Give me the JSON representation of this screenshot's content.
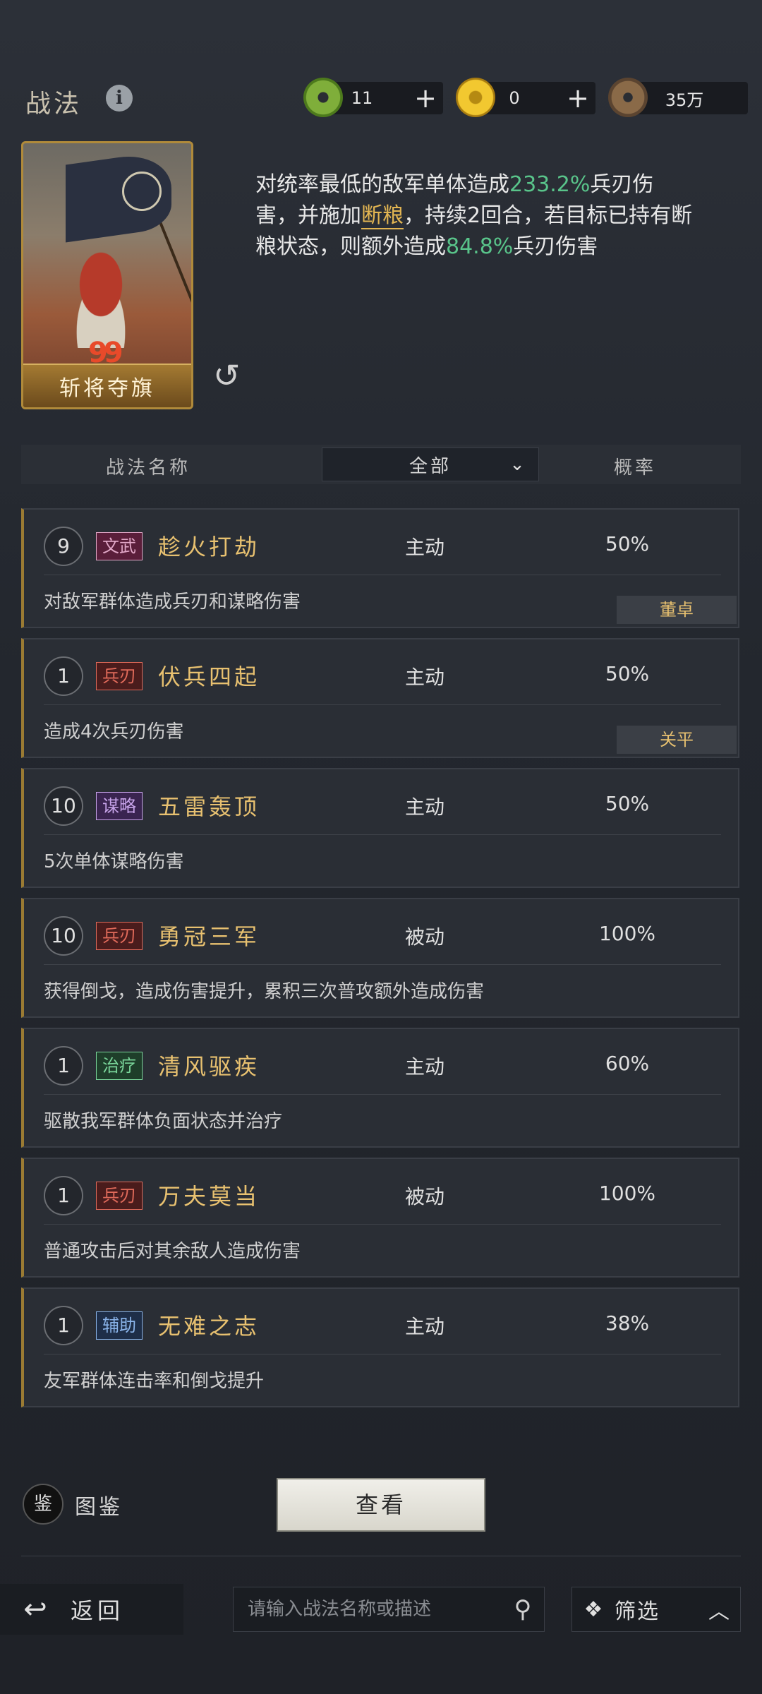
{
  "header": {
    "title": "战法",
    "info_icon": "i",
    "resources": [
      {
        "icon": "jade-coin-icon",
        "value": "11",
        "plus": "+"
      },
      {
        "icon": "gold-coin-icon",
        "value": "0",
        "plus": "+"
      },
      {
        "icon": "copper-coin-icon",
        "value": "35万"
      }
    ]
  },
  "selected": {
    "card_name": "斩将夺旗",
    "card_badge": "99",
    "description": {
      "p1": "对统率最低的敌军单体造成",
      "v1": "233.2%",
      "p2": "兵刃伤害，并施加",
      "link": "断粮",
      "p3": "，持续2回合，若目标已持有断粮状态，则额外造成",
      "v2": "84.8%",
      "p4": "兵刃伤害"
    }
  },
  "table_header": {
    "name": "战法名称",
    "filter": "全部",
    "rate": "概率"
  },
  "tactics": [
    {
      "level": "9",
      "tag": "文武",
      "tag_class": "tag-wenwu",
      "name": "趁火打劫",
      "kind": "主动",
      "rate": "50%",
      "desc": "对敌军群体造成兵刃和谋略伤害",
      "owner": "董卓"
    },
    {
      "level": "1",
      "tag": "兵刃",
      "tag_class": "tag-bing",
      "name": "伏兵四起",
      "kind": "主动",
      "rate": "50%",
      "desc": "造成4次兵刃伤害",
      "owner": "关平"
    },
    {
      "level": "10",
      "tag": "谋略",
      "tag_class": "tag-mou",
      "name": "五雷轰顶",
      "kind": "主动",
      "rate": "50%",
      "desc": "5次单体谋略伤害",
      "owner": ""
    },
    {
      "level": "10",
      "tag": "兵刃",
      "tag_class": "tag-bing",
      "name": "勇冠三军",
      "kind": "被动",
      "rate": "100%",
      "desc": "获得倒戈，造成伤害提升，累积三次普攻额外造成伤害",
      "owner": ""
    },
    {
      "level": "1",
      "tag": "治疗",
      "tag_class": "tag-zhi",
      "name": "清风驱疾",
      "kind": "主动",
      "rate": "60%",
      "desc": "驱散我军群体负面状态并治疗",
      "owner": ""
    },
    {
      "level": "1",
      "tag": "兵刃",
      "tag_class": "tag-bing",
      "name": "万夫莫当",
      "kind": "被动",
      "rate": "100%",
      "desc": "普通攻击后对其余敌人造成伤害",
      "owner": ""
    },
    {
      "level": "1",
      "tag": "辅助",
      "tag_class": "tag-fu",
      "name": "无难之志",
      "kind": "主动",
      "rate": "38%",
      "desc": "友军群体连击率和倒戈提升",
      "owner": ""
    }
  ],
  "footer": {
    "book_icon": "鉴",
    "book_label": "图鉴",
    "view_button": "查看",
    "back_label": "返回",
    "search_placeholder": "请输入战法名称或描述",
    "filter_label": "筛选"
  }
}
